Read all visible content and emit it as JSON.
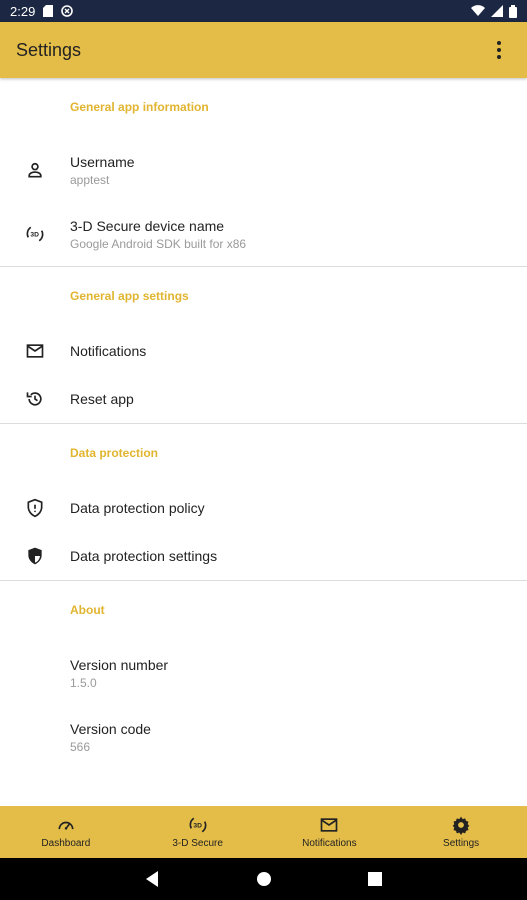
{
  "status_bar": {
    "time": "2:29"
  },
  "app_bar": {
    "title": "Settings"
  },
  "sections": [
    {
      "header": "General app information",
      "items": [
        {
          "icon": "person-icon",
          "primary": "Username",
          "secondary": "apptest"
        },
        {
          "icon": "3d-secure-icon",
          "primary": "3-D Secure device name",
          "secondary": "Google Android SDK built for x86"
        }
      ]
    },
    {
      "header": "General app settings",
      "items": [
        {
          "icon": "mail-icon",
          "primary": "Notifications"
        },
        {
          "icon": "reset-icon",
          "primary": "Reset app"
        }
      ]
    },
    {
      "header": "Data protection",
      "items": [
        {
          "icon": "shield-outline-icon",
          "primary": "Data protection policy"
        },
        {
          "icon": "shield-filled-icon",
          "primary": "Data protection settings"
        }
      ]
    },
    {
      "header": "About",
      "items": [
        {
          "primary": "Version number",
          "secondary": "1.5.0"
        },
        {
          "primary": "Version code",
          "secondary": "566"
        }
      ]
    }
  ],
  "bottom_nav": [
    {
      "icon": "speedometer-icon",
      "label": "Dashboard"
    },
    {
      "icon": "3d-secure-icon",
      "label": "3-D Secure"
    },
    {
      "icon": "mail-icon",
      "label": "Notifications"
    },
    {
      "icon": "gear-icon",
      "label": "Settings"
    }
  ],
  "colors": {
    "accent": "#e4bd48",
    "section_header": "#e1b52f",
    "status_bar": "#1c2743"
  }
}
